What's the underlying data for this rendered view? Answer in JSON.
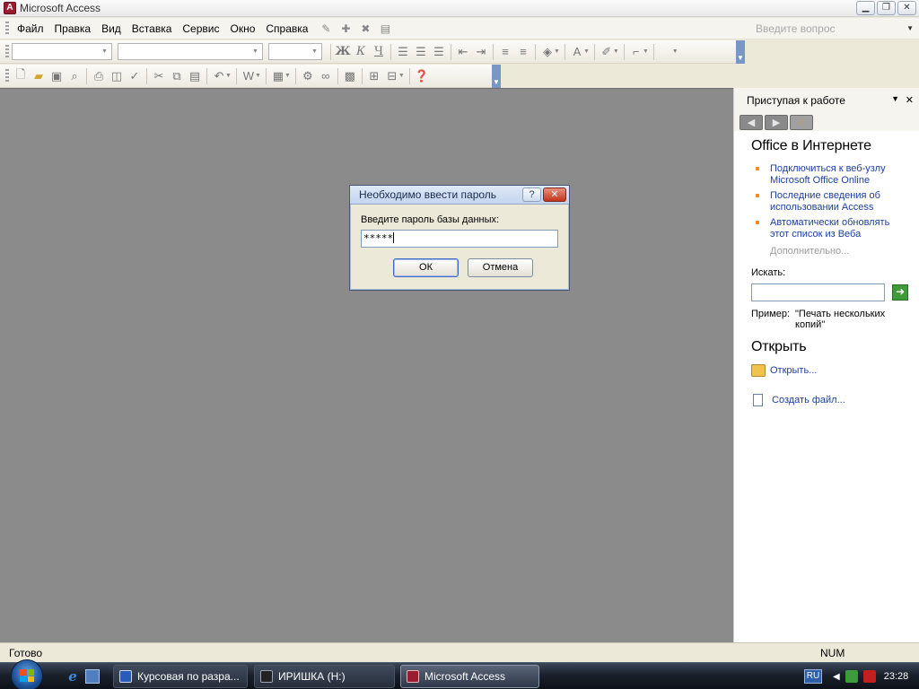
{
  "window": {
    "title": "Microsoft Access",
    "app_icon": "access-icon"
  },
  "menu": {
    "items": [
      {
        "label": "Файл"
      },
      {
        "label": "Правка"
      },
      {
        "label": "Вид"
      },
      {
        "label": "Вставка"
      },
      {
        "label": "Сервис"
      },
      {
        "label": "Окно"
      },
      {
        "label": "Справка"
      }
    ],
    "ask_placeholder": "Введите вопрос"
  },
  "task_pane": {
    "title": "Приступая к работе",
    "office_section": {
      "heading": "Office в Интернете",
      "links": [
        {
          "label": "Подключиться к веб-узлу Microsoft Office Online"
        },
        {
          "label": "Последние сведения об использовании Access"
        },
        {
          "label": "Автоматически обновлять этот список из Веба"
        }
      ],
      "more": "Дополнительно..."
    },
    "search": {
      "label": "Искать:",
      "value": "",
      "example_label": "Пример:",
      "example_value": "\"Печать нескольких копий\""
    },
    "open_section": {
      "heading": "Открыть",
      "open_link": "Открыть...",
      "create_link": "Создать файл..."
    }
  },
  "dialog": {
    "title": "Необходимо ввести пароль",
    "help_label": "?",
    "close_label": "✕",
    "prompt": "Введите пароль базы данных:",
    "password_masked": "*****",
    "ok_label": "ОК",
    "cancel_label": "Отмена"
  },
  "status": {
    "text": "Готово",
    "num": "NUM"
  },
  "taskbar": {
    "buttons": [
      {
        "label": "Курсовая по разра...",
        "icon": "word-icon"
      },
      {
        "label": "ИРИШКА (H:)",
        "icon": "drive-icon"
      },
      {
        "label": "Microsoft Access",
        "icon": "access-icon"
      }
    ],
    "language": "RU",
    "clock": "23:28"
  },
  "colors": {
    "workspace": "#8b8b8b",
    "link": "#1c3fa0",
    "bullet": "#f28c28"
  }
}
